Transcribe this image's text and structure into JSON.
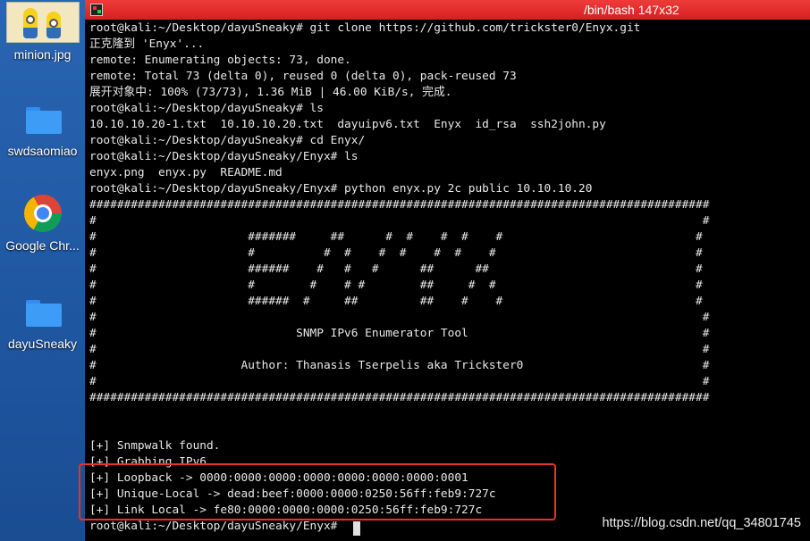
{
  "desktop": {
    "icons": [
      {
        "label": "minion.jpg",
        "icon": "minion-image-icon"
      },
      {
        "label": "swdsaomiao",
        "icon": "folder-icon"
      },
      {
        "label": "Google Chr...",
        "icon": "chrome-icon"
      },
      {
        "label": "dayuSneaky",
        "icon": "folder-icon"
      }
    ]
  },
  "terminal": {
    "title": "/bin/bash 147x32",
    "lines": [
      "root@kali:~/Desktop/dayuSneaky# git clone https://github.com/trickster0/Enyx.git",
      "正克隆到 'Enyx'...",
      "remote: Enumerating objects: 73, done.",
      "remote: Total 73 (delta 0), reused 0 (delta 0), pack-reused 73",
      "展开对象中: 100% (73/73), 1.36 MiB | 46.00 KiB/s, 完成.",
      "root@kali:~/Desktop/dayuSneaky# ls",
      "10.10.10.20-1.txt  10.10.10.20.txt  dayuipv6.txt  Enyx  id_rsa  ssh2john.py",
      "root@kali:~/Desktop/dayuSneaky# cd Enyx/",
      "root@kali:~/Desktop/dayuSneaky/Enyx# ls",
      "enyx.png  enyx.py  README.md",
      "root@kali:~/Desktop/dayuSneaky/Enyx# python enyx.py 2c public 10.10.10.20",
      "##########################################################################################",
      "#                                                                                        #",
      "#                      #######     ##      #  #    #  #    #                            #",
      "#                      #          #  #    #  #    #  #    #                             #",
      "#                      ######    #   #   #      ##      ##                              #",
      "#                      #        #    # #        ##     #  #                             #",
      "#                      ######  #     ##         ##    #    #                            #",
      "#                                                                                        #",
      "#                             SNMP IPv6 Enumerator Tool                                  #",
      "#                                                                                        #",
      "#                     Author: Thanasis Tserpelis aka Trickster0                          #",
      "#                                                                                        #",
      "##########################################################################################",
      "",
      "",
      "[+] Snmpwalk found.",
      "[+] Grabbing IPv6.",
      "[+] Loopback -> 0000:0000:0000:0000:0000:0000:0000:0001",
      "[+] Unique-Local -> dead:beef:0000:0000:0250:56ff:feb9:727c",
      "[+] Link Local -> fe80:0000:0000:0000:0250:56ff:feb9:727c",
      "root@kali:~/Desktop/dayuSneaky/Enyx# "
    ]
  },
  "watermark": "https://blog.csdn.net/qq_34801745",
  "colors": {
    "titlebar": "#e02a2a",
    "highlight": "#e8322a",
    "desktop": "#1f5aa8",
    "terminal_bg": "#000000"
  }
}
